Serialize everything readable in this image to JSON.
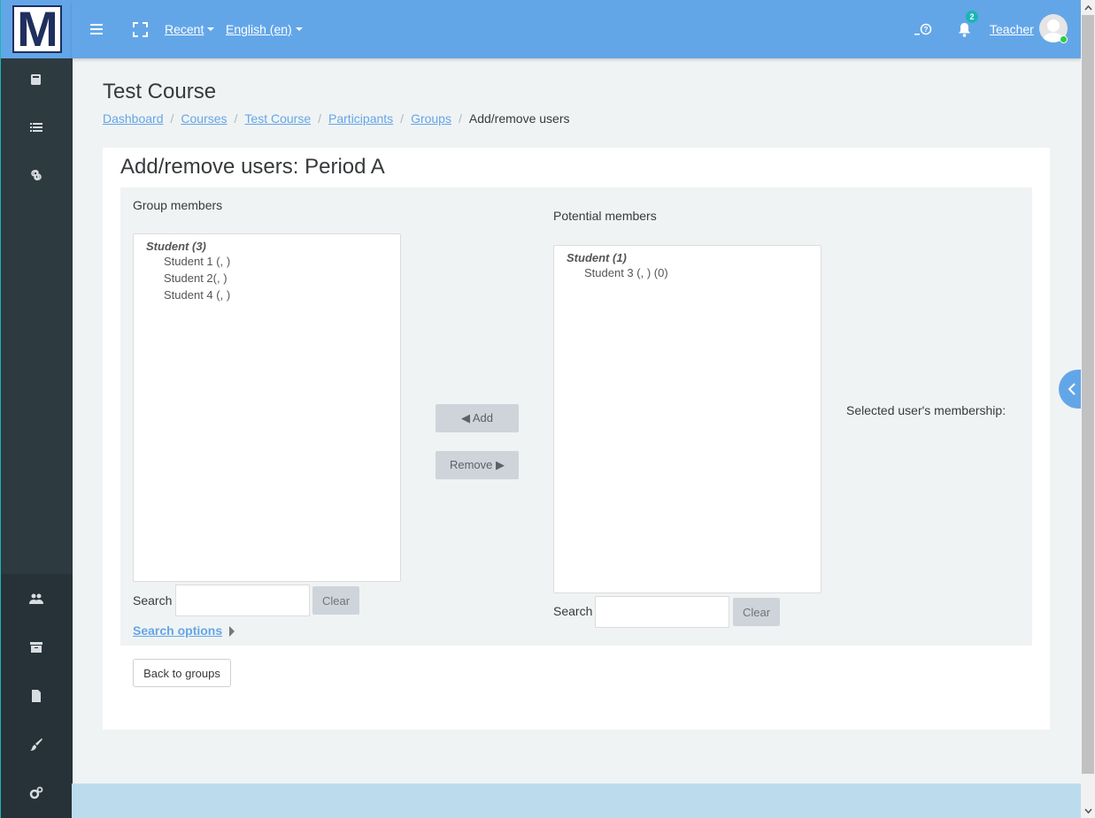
{
  "topbar": {
    "recent_label": "Recent",
    "language_label": "English (en)",
    "notification_count": "2",
    "user_name": "Teacher"
  },
  "logo": {
    "letter": "M"
  },
  "page": {
    "title": "Test Course",
    "breadcrumb": [
      "Dashboard",
      "Courses",
      "Test Course",
      "Participants",
      "Groups",
      "Add/remove users"
    ]
  },
  "card": {
    "title": "Add/remove users: Period A",
    "group_members": {
      "label": "Group members",
      "group_name": "Student (3)",
      "options": [
        "Student 1 (, )",
        "Student 2(, )",
        "Student 4 (, )"
      ]
    },
    "potential_members": {
      "label": "Potential members",
      "group_name": "Student (1)",
      "options": [
        "Student 3 (, ) (0)"
      ]
    },
    "add_label": "◀ Add",
    "remove_label": "Remove ▶",
    "membership_label": "Selected user's membership:",
    "search_label": "Search",
    "clear_label": "Clear",
    "search_options_label": "Search options",
    "back_label": "Back to groups"
  },
  "colors": {
    "brand": "#63a6e8",
    "sidebar": "#263238",
    "accent": "#1bb6b6"
  }
}
